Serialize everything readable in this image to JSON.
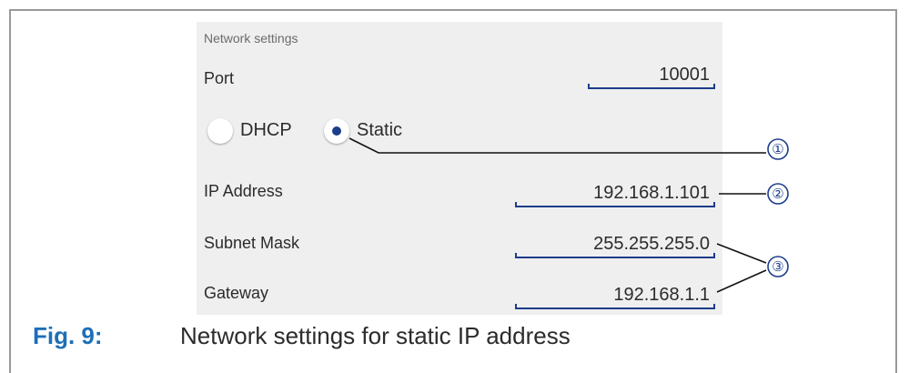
{
  "panel": {
    "title": "Network settings",
    "port": {
      "label": "Port",
      "value": "10001"
    },
    "mode": {
      "options": [
        {
          "label": "DHCP",
          "selected": false
        },
        {
          "label": "Static",
          "selected": true
        }
      ]
    },
    "ip": {
      "label": "IP Address",
      "value": "192.168.1.101"
    },
    "subnet": {
      "label": "Subnet Mask",
      "value": "255.255.255.0"
    },
    "gateway": {
      "label": "Gateway",
      "value": "192.168.1.1"
    }
  },
  "callouts": [
    "①",
    "②",
    "③"
  ],
  "caption": {
    "label": "Fig. 9:",
    "text": "Network settings for static IP address"
  },
  "colors": {
    "accent": "#1c3d8a",
    "caption": "#1c6fb7",
    "panel_bg": "#efefef"
  }
}
